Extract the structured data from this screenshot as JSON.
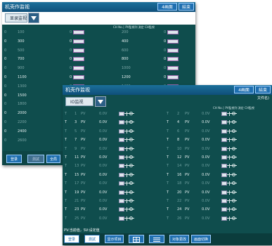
{
  "back": {
    "title": "机壳作监视",
    "btn_screen": "4画面",
    "btn_end": "結束",
    "combo": "显录监视",
    "header": "CH No.│ PV監視列 測定 CH監視",
    "rows": [
      {
        "a": "0",
        "b": "100",
        "c": "0",
        "d": "200",
        "e": "0",
        "dim": true
      },
      {
        "a": "0",
        "b": "300",
        "c": "0",
        "d": "400",
        "e": "0",
        "dim": false
      },
      {
        "a": "0",
        "b": "500",
        "c": "0",
        "d": "600",
        "e": "0",
        "dim": true
      },
      {
        "a": "0",
        "b": "700",
        "c": "0",
        "d": "800",
        "e": "0",
        "dim": false
      },
      {
        "a": "0",
        "b": "900",
        "c": "0",
        "d": "1000",
        "e": "0",
        "dim": true
      },
      {
        "a": "0",
        "b": "1100",
        "c": "0",
        "d": "1200",
        "e": "0",
        "dim": false
      },
      {
        "a": "0",
        "b": "1300",
        "c": "0",
        "d": "1400",
        "e": "0",
        "dim": true
      },
      {
        "a": "0",
        "b": "1500",
        "c": "",
        "d": "",
        "e": "",
        "dim": false
      },
      {
        "a": "0",
        "b": "1800",
        "c": "",
        "d": "",
        "e": "",
        "dim": true
      },
      {
        "a": "0",
        "b": "2000",
        "c": "",
        "d": "",
        "e": "",
        "dim": false
      },
      {
        "a": "0",
        "b": "2200",
        "c": "",
        "d": "",
        "e": "",
        "dim": true
      },
      {
        "a": "0",
        "b": "2400",
        "c": "",
        "d": "",
        "e": "",
        "dim": false
      },
      {
        "a": "0",
        "b": "2600",
        "c": "",
        "d": "",
        "e": "",
        "dim": true
      }
    ],
    "bottom": {
      "b1": "登录",
      "b2": "測試",
      "b3": "全局"
    }
  },
  "front": {
    "title": "机壳作监视",
    "btn_screen": "4画面",
    "btn_end": "結束",
    "file_label": "文件名)",
    "combo": "IO监视",
    "header": "CH No.│ PV監視列 測定 CH監視",
    "sv_label": "0.0V",
    "rows": [
      {
        "l": "T",
        "n1": "1",
        "v1": "0.0V",
        "r": "T",
        "n2": "2",
        "v2": "0.0V",
        "dim": true
      },
      {
        "l": "T",
        "n1": "3",
        "v1": "0.0V",
        "r": "T",
        "n2": "4",
        "v2": "0.0V",
        "dim": false
      },
      {
        "l": "T",
        "n1": "5",
        "v1": "0.0V",
        "r": "T",
        "n2": "6",
        "v2": "0.0V",
        "dim": true
      },
      {
        "l": "T",
        "n1": "7",
        "v1": "0.0V",
        "r": "T",
        "n2": "8",
        "v2": "0.0V",
        "dim": false
      },
      {
        "l": "T",
        "n1": "9",
        "v1": "0.0V",
        "r": "T",
        "n2": "10",
        "v2": "0.0V",
        "dim": true
      },
      {
        "l": "T",
        "n1": "11",
        "v1": "0.0V",
        "r": "T",
        "n2": "12",
        "v2": "0.0V",
        "dim": false
      },
      {
        "l": "T",
        "n1": "13",
        "v1": "0.0V",
        "r": "T",
        "n2": "14",
        "v2": "0.0V",
        "dim": true
      },
      {
        "l": "T",
        "n1": "15",
        "v1": "0.0V",
        "r": "T",
        "n2": "16",
        "v2": "0.0V",
        "dim": false
      },
      {
        "l": "T",
        "n1": "17",
        "v1": "0.0V",
        "r": "T",
        "n2": "18",
        "v2": "0.0V",
        "dim": true
      },
      {
        "l": "T",
        "n1": "19",
        "v1": "0.0V",
        "r": "T",
        "n2": "20",
        "v2": "0.0V",
        "dim": false
      },
      {
        "l": "T",
        "n1": "21",
        "v1": "0.0V",
        "r": "T",
        "n2": "22",
        "v2": "0.0V",
        "dim": true
      },
      {
        "l": "T",
        "n1": "23",
        "v1": "0.0V",
        "r": "T",
        "n2": "24",
        "v2": "0.0V",
        "dim": false
      },
      {
        "l": "T",
        "n1": "25",
        "v1": "0.0V",
        "r": "T",
        "n2": "26",
        "v2": "0.0V",
        "dim": true
      }
    ],
    "pv_tag": "PV",
    "status": "PV:当前值，SV:设定值",
    "bottom": [
      "登录",
      "測試",
      "显示项目",
      "",
      "",
      "对象更改",
      "画面切换"
    ]
  }
}
